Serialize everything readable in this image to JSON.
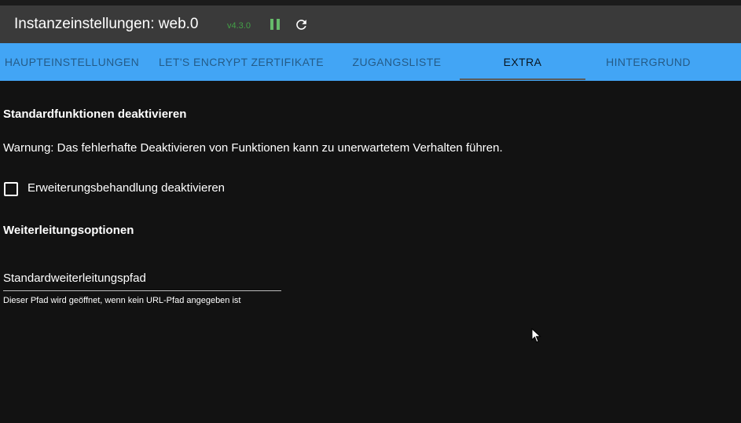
{
  "header": {
    "title": "Instanzeinstellungen: web.0",
    "version": "v4.3.0",
    "version_color": "#43a047",
    "pause_icon": "pause-icon",
    "reload_icon": "reload-icon"
  },
  "tabs": {
    "accent": "#42a5f5",
    "items": [
      {
        "label": "HAUPTEINSTELLUNGEN",
        "active": false
      },
      {
        "label": "LET'S ENCRYPT ZERTIFIKATE",
        "active": false
      },
      {
        "label": "ZUGANGSLISTE",
        "active": false
      },
      {
        "label": "EXTRA",
        "active": true
      },
      {
        "label": "HINTERGRUND",
        "active": false
      }
    ]
  },
  "extra": {
    "section1_title": "Standardfunktionen deaktivieren",
    "warning": "Warnung: Das fehlerhafte Deaktivieren von Funktionen kann zu unerwartetem Verhalten führen.",
    "checkbox_label": "Erweiterungsbehandlung deaktivieren",
    "checkbox_checked": false,
    "section2_title": "Weiterleitungsoptionen",
    "redirect_field_label": "Standardweiterleitungspfad",
    "redirect_field_helper": "Dieser Pfad wird geöffnet, wenn kein URL-Pfad angegeben ist"
  }
}
